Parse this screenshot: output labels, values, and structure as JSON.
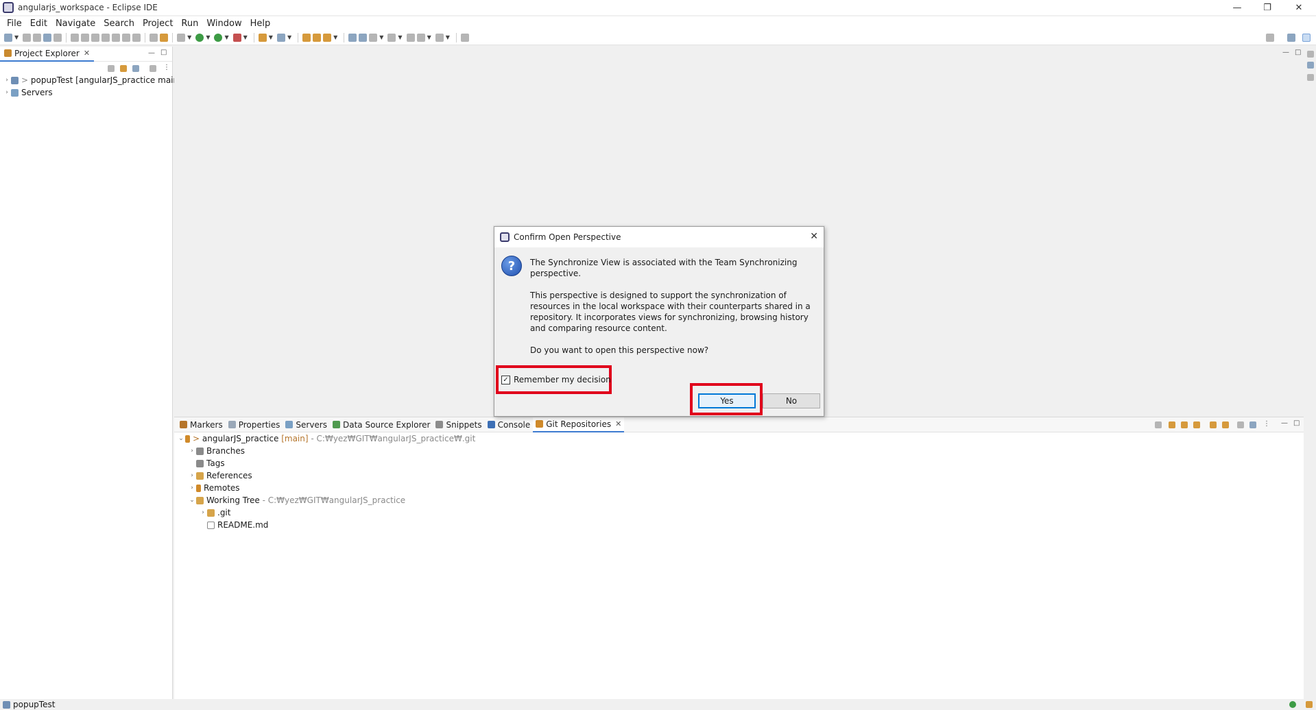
{
  "window": {
    "title": "angularjs_workspace - Eclipse IDE",
    "minimize": "—",
    "restore": "❐",
    "close": "✕"
  },
  "menu": [
    "File",
    "Edit",
    "Navigate",
    "Search",
    "Project",
    "Run",
    "Window",
    "Help"
  ],
  "project_explorer": {
    "tab_label": "Project Explorer",
    "close": "✕",
    "items": [
      {
        "prefix": ">",
        "label": "popupTest",
        "suffix": "[angularJS_practice main]"
      },
      {
        "prefix": "",
        "label": "Servers",
        "suffix": ""
      }
    ]
  },
  "bottom_tabs": [
    "Markers",
    "Properties",
    "Servers",
    "Data Source Explorer",
    "Snippets",
    "Console",
    "Git Repositories"
  ],
  "bottom_tab_close": "✕",
  "git_tree": {
    "repo": {
      "prefix": ">",
      "name": "angularJS_practice",
      "branch": "[main]",
      "path": "- C:₩yez₩GIT₩angularJS_practice₩.git"
    },
    "branches": "Branches",
    "tags": "Tags",
    "references": "References",
    "remotes": "Remotes",
    "working_tree": {
      "name": "Working Tree",
      "path": "- C:₩yez₩GIT₩angularJS_practice"
    },
    "git_folder": ".git",
    "readme": "README.md"
  },
  "status_bar": {
    "text": "popupTest"
  },
  "dialog": {
    "title": "Confirm Open Perspective",
    "close": "✕",
    "message_1": "The Synchronize View is associated with the Team Synchronizing perspective.",
    "message_2": "This perspective is designed to support the synchronization of resources in the local workspace with their counterparts shared in a repository. It incorporates views for synchronizing, browsing history and comparing resource content.",
    "question": "Do you want to open this perspective now?",
    "remember_label": "Remember my decision",
    "remember_checked": true,
    "yes_label": "Yes",
    "no_label": "No",
    "highlight_color": "#e0001b"
  }
}
